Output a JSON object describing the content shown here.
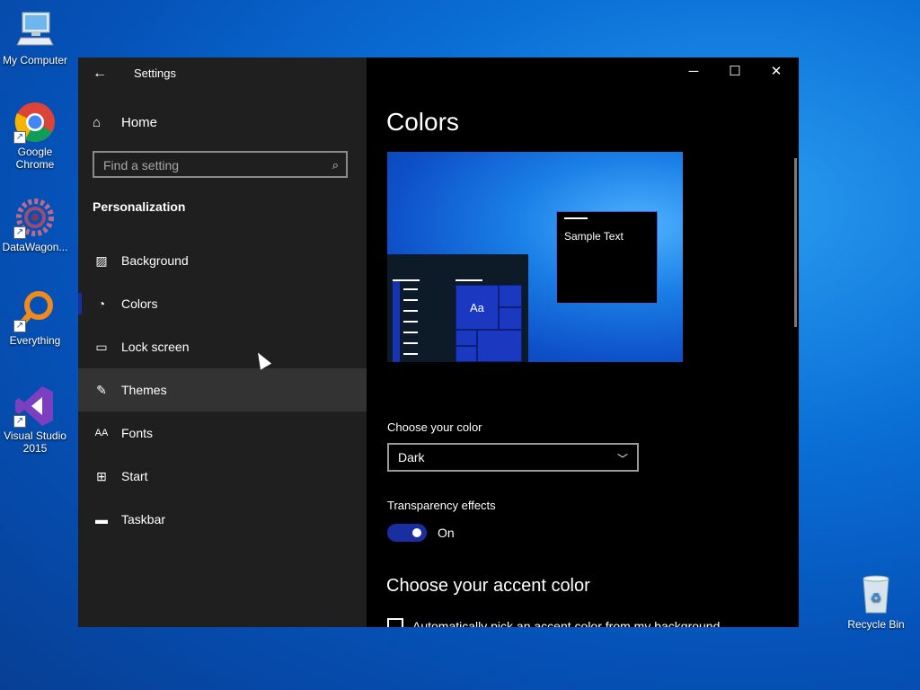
{
  "desktop": {
    "icons": [
      {
        "label": "My Computer"
      },
      {
        "label": "Google Chrome"
      },
      {
        "label": "DataWagon..."
      },
      {
        "label": "Everything"
      },
      {
        "label": "Visual Studio 2015"
      },
      {
        "label": "Recycle Bin"
      }
    ]
  },
  "window": {
    "title": "Settings",
    "back_icon": "back-arrow-icon",
    "controls": {
      "minimize": "─",
      "maximize": "☐",
      "close": "✕"
    }
  },
  "sidebar": {
    "home_label": "Home",
    "search_placeholder": "Find a setting",
    "section_title": "Personalization",
    "items": [
      {
        "label": "Background",
        "icon": "image-icon"
      },
      {
        "label": "Colors",
        "icon": "palette-icon",
        "selected": true
      },
      {
        "label": "Lock screen",
        "icon": "lock-screen-icon"
      },
      {
        "label": "Themes",
        "icon": "themes-icon",
        "hovered": true
      },
      {
        "label": "Fonts",
        "icon": "fonts-icon"
      },
      {
        "label": "Start",
        "icon": "start-icon"
      },
      {
        "label": "Taskbar",
        "icon": "taskbar-icon"
      }
    ]
  },
  "content": {
    "title": "Colors",
    "preview_sample_text": "Sample Text",
    "preview_tile_text": "Aa",
    "choose_color_label": "Choose your color",
    "choose_color_value": "Dark",
    "transparency_label": "Transparency effects",
    "transparency_state": "On",
    "accent_title": "Choose your accent color",
    "auto_accent_label": "Automatically pick an accent color from my background"
  },
  "colors": {
    "accent": "#1a2ea0",
    "sidebar_bg": "#1f1f1f",
    "content_bg": "#000000"
  }
}
